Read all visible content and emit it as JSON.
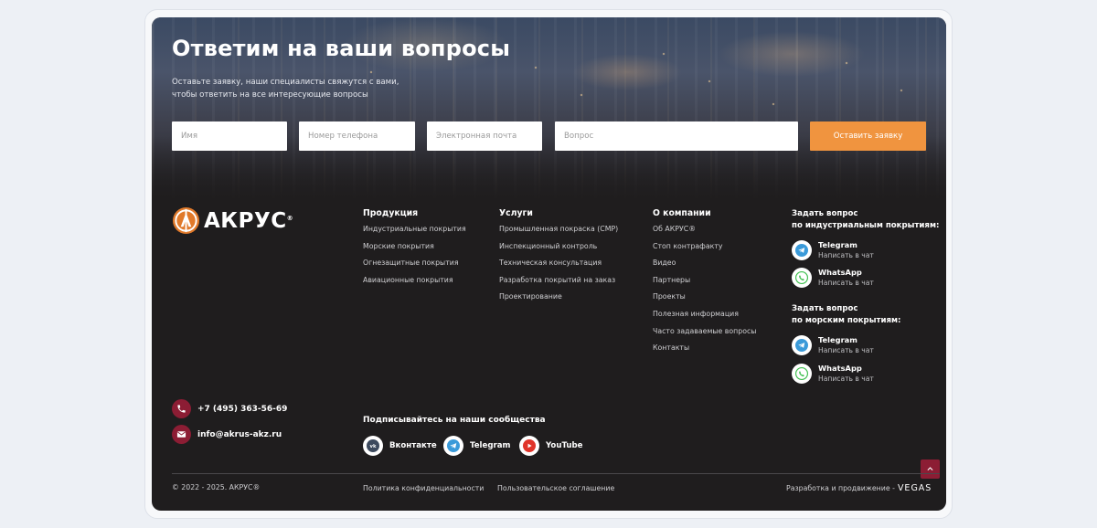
{
  "hero": {
    "title": "Ответим на ваши вопросы",
    "subtitle": "Оставьте заявку, наши специалисты свяжутся с вами, чтобы ответить на все интересующие вопросы",
    "form": {
      "name_placeholder": "Имя",
      "phone_placeholder": "Номер телефона",
      "email_placeholder": "Электронная почта",
      "question_placeholder": "Вопрос",
      "submit_label": "Оставить заявку"
    }
  },
  "logo": {
    "text": "АКРУС",
    "reg": "®"
  },
  "columns": {
    "products": {
      "title": "Продукция",
      "links": [
        "Индустриальные покрытия",
        "Морские покрытия",
        "Огнезащитные покрытия",
        "Авиационные покрытия"
      ]
    },
    "services": {
      "title": "Услуги",
      "links": [
        "Промышленная покраска (CMP)",
        "Инспекционный контроль",
        "Техническая консультация",
        "Разработка покрытий на заказ",
        "Проектирование"
      ]
    },
    "company": {
      "title": "О компании",
      "links": [
        "Об АКРУС®",
        "Стоп контрафакту",
        "Видео",
        "Партнеры",
        "Проекты",
        "Полезная информация",
        "Часто задаваемые вопросы",
        "Контакты"
      ]
    }
  },
  "ask_industrial": {
    "title_line1": "Задать вопрос",
    "title_line2": "по индустриальным покрытиям:",
    "telegram": {
      "name": "Telegram",
      "sub": "Написать в чат"
    },
    "whatsapp": {
      "name": "WhatsApp",
      "sub": "Написать в чат"
    }
  },
  "ask_marine": {
    "title_line1": "Задать вопрос",
    "title_line2": "по морским покрытиям:",
    "telegram": {
      "name": "Telegram",
      "sub": "Написать в чат"
    },
    "whatsapp": {
      "name": "WhatsApp",
      "sub": "Написать в чат"
    }
  },
  "contacts": {
    "phone": "+7 (495) 363-56-69",
    "email": "info@akrus-akz.ru"
  },
  "social": {
    "title": "Подписывайтесь на наши сообщества",
    "vk": "Вконтакте",
    "telegram": "Telegram",
    "youtube": "YouTube"
  },
  "footer": {
    "copyright": "© 2022 - 2025. АКРУС®",
    "privacy": "Политика конфиденциальности",
    "agreement": "Пользовательское соглашение",
    "dev_label": "Разработка и продвижение -",
    "dev_brand": "VEGAS"
  },
  "colors": {
    "accent_orange": "#f0943f",
    "brand_red": "#8c1d34",
    "dark_bg": "#1f1d1e"
  }
}
